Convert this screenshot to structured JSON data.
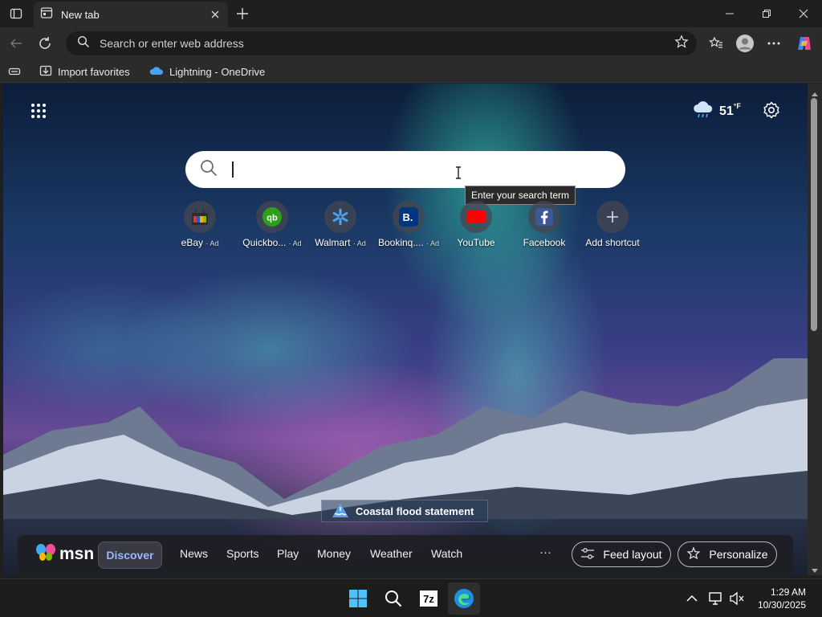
{
  "browser": {
    "tab": {
      "title": "New tab"
    },
    "address_bar": {
      "placeholder": "Search or enter web address"
    },
    "favorites": [
      {
        "label": "Import favorites",
        "icon": "import-icon"
      },
      {
        "label": "Lightning - OneDrive",
        "icon": "onedrive-icon"
      }
    ]
  },
  "newtab": {
    "weather": {
      "temperature": "51",
      "unit": "°F",
      "icon": "cloud-rain-icon"
    },
    "search": {
      "tooltip": "Enter your search term"
    },
    "shortcuts": [
      {
        "label": "eBay",
        "ad": "· Ad",
        "icon": "ebay-icon"
      },
      {
        "label": "Quickbo...",
        "ad": "· Ad",
        "icon": "quickbooks-icon"
      },
      {
        "label": "Walmart",
        "ad": "· Ad",
        "icon": "walmart-icon"
      },
      {
        "label": "Bookinq....",
        "ad": "· Ad",
        "icon": "booking-icon"
      },
      {
        "label": "YouTube",
        "ad": "",
        "icon": "youtube-icon"
      },
      {
        "label": "Facebook",
        "ad": "",
        "icon": "facebook-icon"
      },
      {
        "label": "Add shortcut",
        "ad": "",
        "icon": "plus-icon"
      }
    ],
    "alert": {
      "text": "Coastal flood statement"
    },
    "msn": {
      "logo": "msn",
      "active_tab": "Discover",
      "tabs": [
        "News",
        "Sports",
        "Play",
        "Money",
        "Weather",
        "Watch"
      ],
      "more": "···",
      "feed_layout": "Feed layout",
      "personalize": "Personalize"
    }
  },
  "taskbar": {
    "clock": {
      "time": "1:29 AM",
      "date": "10/30/2025"
    }
  },
  "colors": {
    "accent": "#9ab7ff",
    "chrome": "#2b2b2b",
    "taskbar": "#1c1c1c"
  }
}
